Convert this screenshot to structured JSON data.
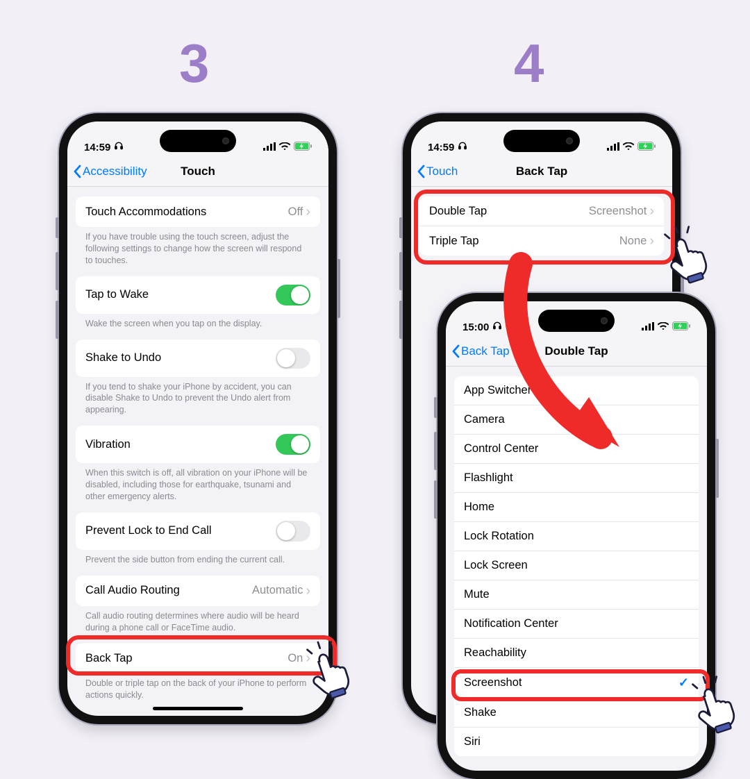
{
  "steps": {
    "left": "3",
    "right": "4"
  },
  "status": {
    "time1": "14:59",
    "time2": "14:59",
    "time3": "15:00"
  },
  "phone1": {
    "back": "Accessibility",
    "title": "Touch",
    "rows": {
      "touchAccom": {
        "label": "Touch Accommodations",
        "value": "Off"
      },
      "touchAccomFooter": "If you have trouble using the touch screen, adjust the following settings to change how the screen will respond to touches.",
      "tapWake": {
        "label": "Tap to Wake"
      },
      "tapWakeFooter": "Wake the screen when you tap on the display.",
      "shakeUndo": {
        "label": "Shake to Undo"
      },
      "shakeUndoFooter": "If you tend to shake your iPhone by accident, you can disable Shake to Undo to prevent the Undo alert from appearing.",
      "vibration": {
        "label": "Vibration"
      },
      "vibrationFooter": "When this switch is off, all vibration on your iPhone will be disabled, including those for earthquake, tsunami and other emergency alerts.",
      "preventLock": {
        "label": "Prevent Lock to End Call"
      },
      "preventLockFooter": "Prevent the side button from ending the current call.",
      "callAudio": {
        "label": "Call Audio Routing",
        "value": "Automatic"
      },
      "callAudioFooter": "Call audio routing determines where audio will be heard during a phone call or FaceTime audio.",
      "backTap": {
        "label": "Back Tap",
        "value": "On"
      },
      "backTapFooter": "Double or triple tap on the back of your iPhone to perform actions quickly."
    }
  },
  "phone2": {
    "back": "Touch",
    "title": "Back Tap",
    "doubleTap": {
      "label": "Double Tap",
      "value": "Screenshot"
    },
    "tripleTap": {
      "label": "Triple Tap",
      "value": "None"
    }
  },
  "phone3": {
    "back": "Back Tap",
    "title": "Double Tap",
    "actions": [
      "App Switcher",
      "Camera",
      "Control Center",
      "Flashlight",
      "Home",
      "Lock Rotation",
      "Lock Screen",
      "Mute",
      "Notification Center",
      "Reachability",
      "Screenshot",
      "Shake",
      "Siri"
    ],
    "selected": "Screenshot"
  }
}
